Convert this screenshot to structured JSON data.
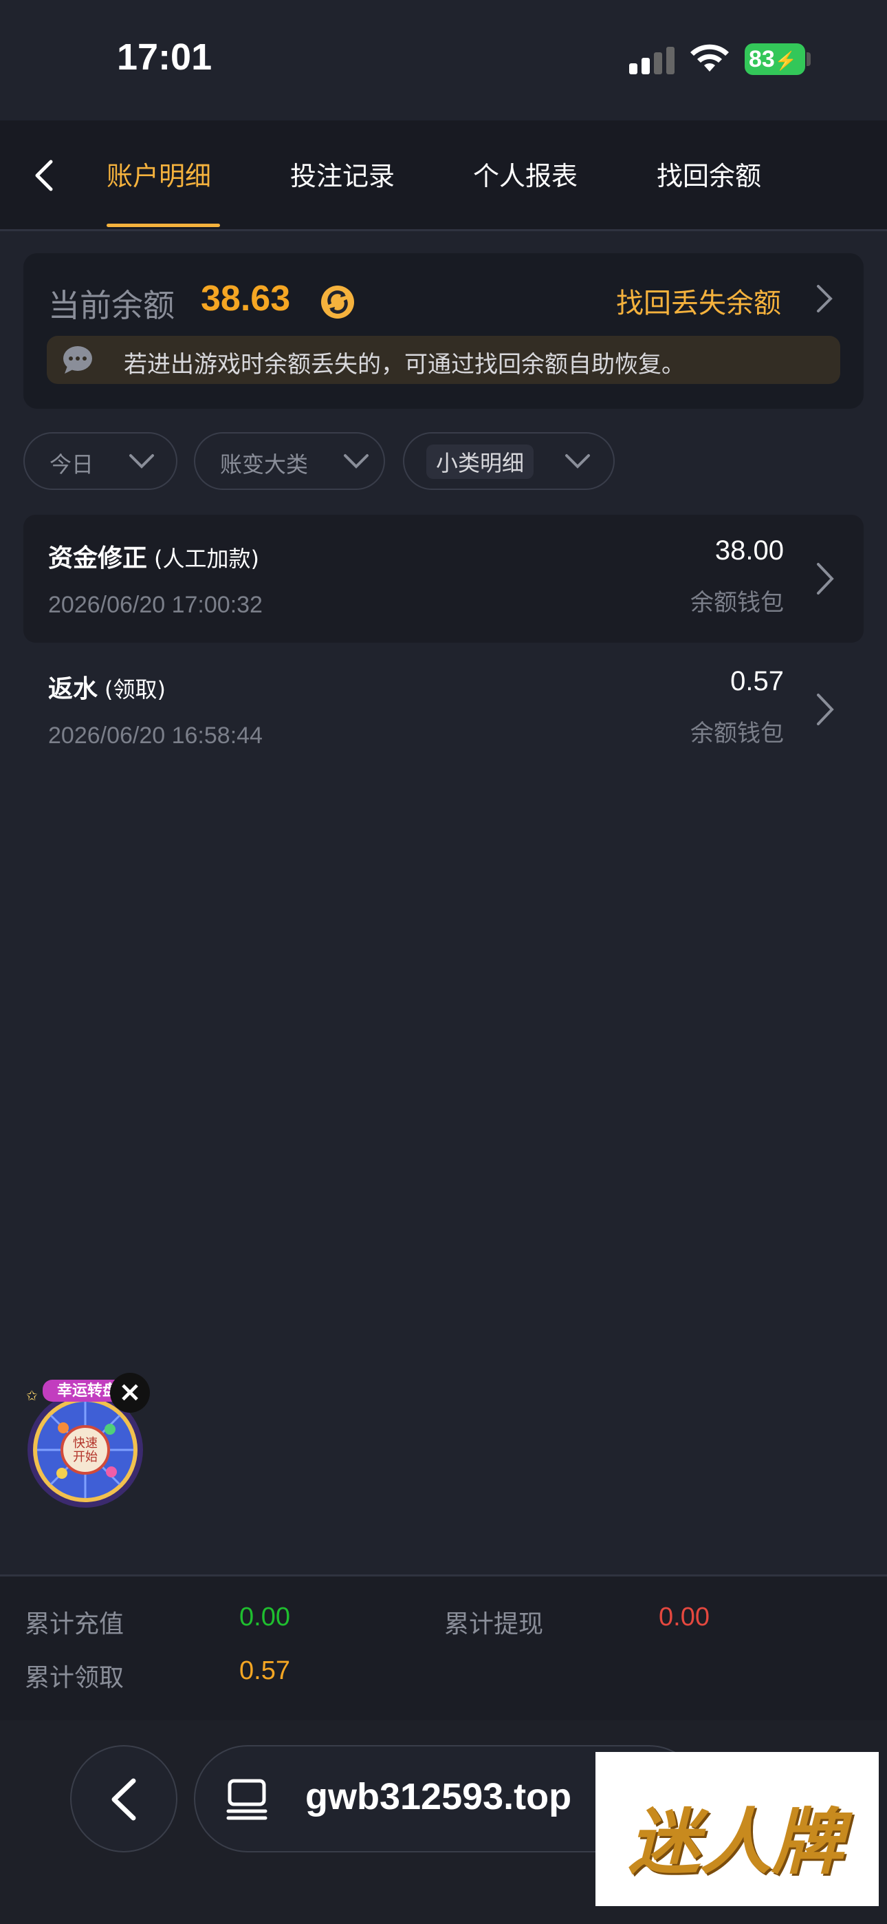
{
  "status_bar": {
    "time": "17:01",
    "battery": "83"
  },
  "nav": {
    "tabs": [
      {
        "label": "账户明细",
        "active": true
      },
      {
        "label": "投注记录",
        "active": false
      },
      {
        "label": "个人报表",
        "active": false
      },
      {
        "label": "找回余额",
        "active": false
      }
    ]
  },
  "balance": {
    "label": "当前余额",
    "value": "38.63",
    "recover_link": "找回丢失余额",
    "notice": "若进出游戏时余额丢失的，可通过找回余额自助恢复。"
  },
  "filters": [
    {
      "label": "今日"
    },
    {
      "label": "账变大类"
    },
    {
      "label": "小类明细"
    }
  ],
  "transactions": [
    {
      "title": "资金修正",
      "sub": "(人工加款)",
      "time": "2026/06/20 17:00:32",
      "amount": "38.00",
      "wallet": "余额钱包"
    },
    {
      "title": "返水",
      "sub": "(领取)",
      "time": "2026/06/20 16:58:44",
      "amount": "0.57",
      "wallet": "余额钱包"
    }
  ],
  "promo": {
    "center_text": "快速开始",
    "banner": "幸运转盘"
  },
  "summary": {
    "recharge_label": "累计充值",
    "recharge_value": "0.00",
    "withdraw_label": "累计提现",
    "withdraw_value": "0.00",
    "claim_label": "累计领取",
    "claim_value": "0.57"
  },
  "colors": {
    "accent": "#f5b23d",
    "green": "#1fbf2f",
    "red": "#e5483f",
    "orange": "#f5a623"
  },
  "browser": {
    "url": "gwb312593.top"
  },
  "watermark": {
    "text": "迷人牌"
  }
}
